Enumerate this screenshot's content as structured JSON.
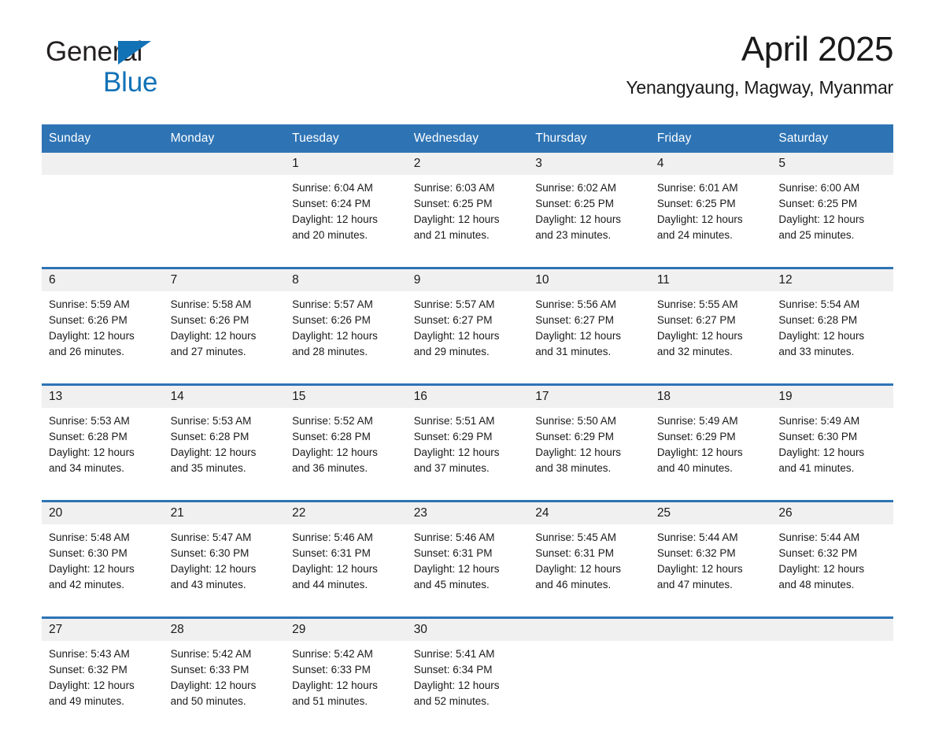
{
  "brand": {
    "name_part1": "General",
    "name_part2": "Blue",
    "accent_color": "#1272b6",
    "logo_icon": "triangle-flag-icon"
  },
  "header": {
    "title": "April 2025",
    "location": "Yenangyaung, Magway, Myanmar"
  },
  "calendar": {
    "header_color": "#2e74b5",
    "daynum_band_color": "#f0f0f0",
    "weekday_headers": [
      "Sunday",
      "Monday",
      "Tuesday",
      "Wednesday",
      "Thursday",
      "Friday",
      "Saturday"
    ],
    "weeks": [
      [
        {
          "day": "",
          "sunrise": "",
          "sunset": "",
          "daylight_line1": "",
          "daylight_line2": ""
        },
        {
          "day": "",
          "sunrise": "",
          "sunset": "",
          "daylight_line1": "",
          "daylight_line2": ""
        },
        {
          "day": "1",
          "sunrise": "Sunrise: 6:04 AM",
          "sunset": "Sunset: 6:24 PM",
          "daylight_line1": "Daylight: 12 hours",
          "daylight_line2": "and 20 minutes."
        },
        {
          "day": "2",
          "sunrise": "Sunrise: 6:03 AM",
          "sunset": "Sunset: 6:25 PM",
          "daylight_line1": "Daylight: 12 hours",
          "daylight_line2": "and 21 minutes."
        },
        {
          "day": "3",
          "sunrise": "Sunrise: 6:02 AM",
          "sunset": "Sunset: 6:25 PM",
          "daylight_line1": "Daylight: 12 hours",
          "daylight_line2": "and 23 minutes."
        },
        {
          "day": "4",
          "sunrise": "Sunrise: 6:01 AM",
          "sunset": "Sunset: 6:25 PM",
          "daylight_line1": "Daylight: 12 hours",
          "daylight_line2": "and 24 minutes."
        },
        {
          "day": "5",
          "sunrise": "Sunrise: 6:00 AM",
          "sunset": "Sunset: 6:25 PM",
          "daylight_line1": "Daylight: 12 hours",
          "daylight_line2": "and 25 minutes."
        }
      ],
      [
        {
          "day": "6",
          "sunrise": "Sunrise: 5:59 AM",
          "sunset": "Sunset: 6:26 PM",
          "daylight_line1": "Daylight: 12 hours",
          "daylight_line2": "and 26 minutes."
        },
        {
          "day": "7",
          "sunrise": "Sunrise: 5:58 AM",
          "sunset": "Sunset: 6:26 PM",
          "daylight_line1": "Daylight: 12 hours",
          "daylight_line2": "and 27 minutes."
        },
        {
          "day": "8",
          "sunrise": "Sunrise: 5:57 AM",
          "sunset": "Sunset: 6:26 PM",
          "daylight_line1": "Daylight: 12 hours",
          "daylight_line2": "and 28 minutes."
        },
        {
          "day": "9",
          "sunrise": "Sunrise: 5:57 AM",
          "sunset": "Sunset: 6:27 PM",
          "daylight_line1": "Daylight: 12 hours",
          "daylight_line2": "and 29 minutes."
        },
        {
          "day": "10",
          "sunrise": "Sunrise: 5:56 AM",
          "sunset": "Sunset: 6:27 PM",
          "daylight_line1": "Daylight: 12 hours",
          "daylight_line2": "and 31 minutes."
        },
        {
          "day": "11",
          "sunrise": "Sunrise: 5:55 AM",
          "sunset": "Sunset: 6:27 PM",
          "daylight_line1": "Daylight: 12 hours",
          "daylight_line2": "and 32 minutes."
        },
        {
          "day": "12",
          "sunrise": "Sunrise: 5:54 AM",
          "sunset": "Sunset: 6:28 PM",
          "daylight_line1": "Daylight: 12 hours",
          "daylight_line2": "and 33 minutes."
        }
      ],
      [
        {
          "day": "13",
          "sunrise": "Sunrise: 5:53 AM",
          "sunset": "Sunset: 6:28 PM",
          "daylight_line1": "Daylight: 12 hours",
          "daylight_line2": "and 34 minutes."
        },
        {
          "day": "14",
          "sunrise": "Sunrise: 5:53 AM",
          "sunset": "Sunset: 6:28 PM",
          "daylight_line1": "Daylight: 12 hours",
          "daylight_line2": "and 35 minutes."
        },
        {
          "day": "15",
          "sunrise": "Sunrise: 5:52 AM",
          "sunset": "Sunset: 6:28 PM",
          "daylight_line1": "Daylight: 12 hours",
          "daylight_line2": "and 36 minutes."
        },
        {
          "day": "16",
          "sunrise": "Sunrise: 5:51 AM",
          "sunset": "Sunset: 6:29 PM",
          "daylight_line1": "Daylight: 12 hours",
          "daylight_line2": "and 37 minutes."
        },
        {
          "day": "17",
          "sunrise": "Sunrise: 5:50 AM",
          "sunset": "Sunset: 6:29 PM",
          "daylight_line1": "Daylight: 12 hours",
          "daylight_line2": "and 38 minutes."
        },
        {
          "day": "18",
          "sunrise": "Sunrise: 5:49 AM",
          "sunset": "Sunset: 6:29 PM",
          "daylight_line1": "Daylight: 12 hours",
          "daylight_line2": "and 40 minutes."
        },
        {
          "day": "19",
          "sunrise": "Sunrise: 5:49 AM",
          "sunset": "Sunset: 6:30 PM",
          "daylight_line1": "Daylight: 12 hours",
          "daylight_line2": "and 41 minutes."
        }
      ],
      [
        {
          "day": "20",
          "sunrise": "Sunrise: 5:48 AM",
          "sunset": "Sunset: 6:30 PM",
          "daylight_line1": "Daylight: 12 hours",
          "daylight_line2": "and 42 minutes."
        },
        {
          "day": "21",
          "sunrise": "Sunrise: 5:47 AM",
          "sunset": "Sunset: 6:30 PM",
          "daylight_line1": "Daylight: 12 hours",
          "daylight_line2": "and 43 minutes."
        },
        {
          "day": "22",
          "sunrise": "Sunrise: 5:46 AM",
          "sunset": "Sunset: 6:31 PM",
          "daylight_line1": "Daylight: 12 hours",
          "daylight_line2": "and 44 minutes."
        },
        {
          "day": "23",
          "sunrise": "Sunrise: 5:46 AM",
          "sunset": "Sunset: 6:31 PM",
          "daylight_line1": "Daylight: 12 hours",
          "daylight_line2": "and 45 minutes."
        },
        {
          "day": "24",
          "sunrise": "Sunrise: 5:45 AM",
          "sunset": "Sunset: 6:31 PM",
          "daylight_line1": "Daylight: 12 hours",
          "daylight_line2": "and 46 minutes."
        },
        {
          "day": "25",
          "sunrise": "Sunrise: 5:44 AM",
          "sunset": "Sunset: 6:32 PM",
          "daylight_line1": "Daylight: 12 hours",
          "daylight_line2": "and 47 minutes."
        },
        {
          "day": "26",
          "sunrise": "Sunrise: 5:44 AM",
          "sunset": "Sunset: 6:32 PM",
          "daylight_line1": "Daylight: 12 hours",
          "daylight_line2": "and 48 minutes."
        }
      ],
      [
        {
          "day": "27",
          "sunrise": "Sunrise: 5:43 AM",
          "sunset": "Sunset: 6:32 PM",
          "daylight_line1": "Daylight: 12 hours",
          "daylight_line2": "and 49 minutes."
        },
        {
          "day": "28",
          "sunrise": "Sunrise: 5:42 AM",
          "sunset": "Sunset: 6:33 PM",
          "daylight_line1": "Daylight: 12 hours",
          "daylight_line2": "and 50 minutes."
        },
        {
          "day": "29",
          "sunrise": "Sunrise: 5:42 AM",
          "sunset": "Sunset: 6:33 PM",
          "daylight_line1": "Daylight: 12 hours",
          "daylight_line2": "and 51 minutes."
        },
        {
          "day": "30",
          "sunrise": "Sunrise: 5:41 AM",
          "sunset": "Sunset: 6:34 PM",
          "daylight_line1": "Daylight: 12 hours",
          "daylight_line2": "and 52 minutes."
        },
        {
          "day": "",
          "sunrise": "",
          "sunset": "",
          "daylight_line1": "",
          "daylight_line2": ""
        },
        {
          "day": "",
          "sunrise": "",
          "sunset": "",
          "daylight_line1": "",
          "daylight_line2": ""
        },
        {
          "day": "",
          "sunrise": "",
          "sunset": "",
          "daylight_line1": "",
          "daylight_line2": ""
        }
      ]
    ]
  }
}
